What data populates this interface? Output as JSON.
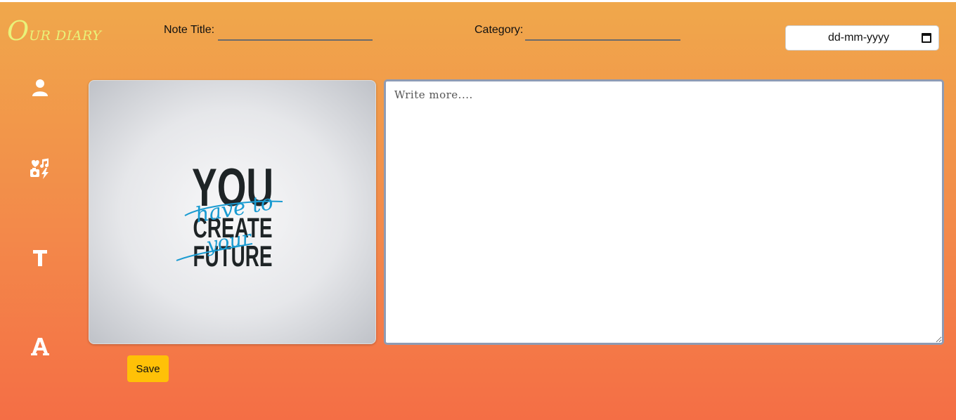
{
  "logo": {
    "first_letter": "O",
    "rest": "UR DIARY"
  },
  "header": {
    "note_title_label": "Note Title:",
    "note_title_value": "",
    "category_label": "Category:",
    "category_value": "",
    "date_placeholder": "dd-mm-yyyy"
  },
  "sidebar": {
    "items": [
      {
        "icon": "user-icon"
      },
      {
        "icon": "media-icon"
      },
      {
        "icon": "text-icon"
      },
      {
        "icon": "font-icon"
      }
    ]
  },
  "image_card": {
    "line1": "YOU",
    "script1": "have to",
    "line2": "CREATE",
    "script2": "your",
    "line3": "FUTURE"
  },
  "editor": {
    "placeholder": "Write more....",
    "value": ""
  },
  "actions": {
    "save_label": "Save"
  },
  "colors": {
    "gradient_top": "#f0a84b",
    "gradient_bottom": "#f46e45",
    "logo": "#e8f27a",
    "save_button": "#ffc107",
    "script_text": "#1a9bd1"
  }
}
